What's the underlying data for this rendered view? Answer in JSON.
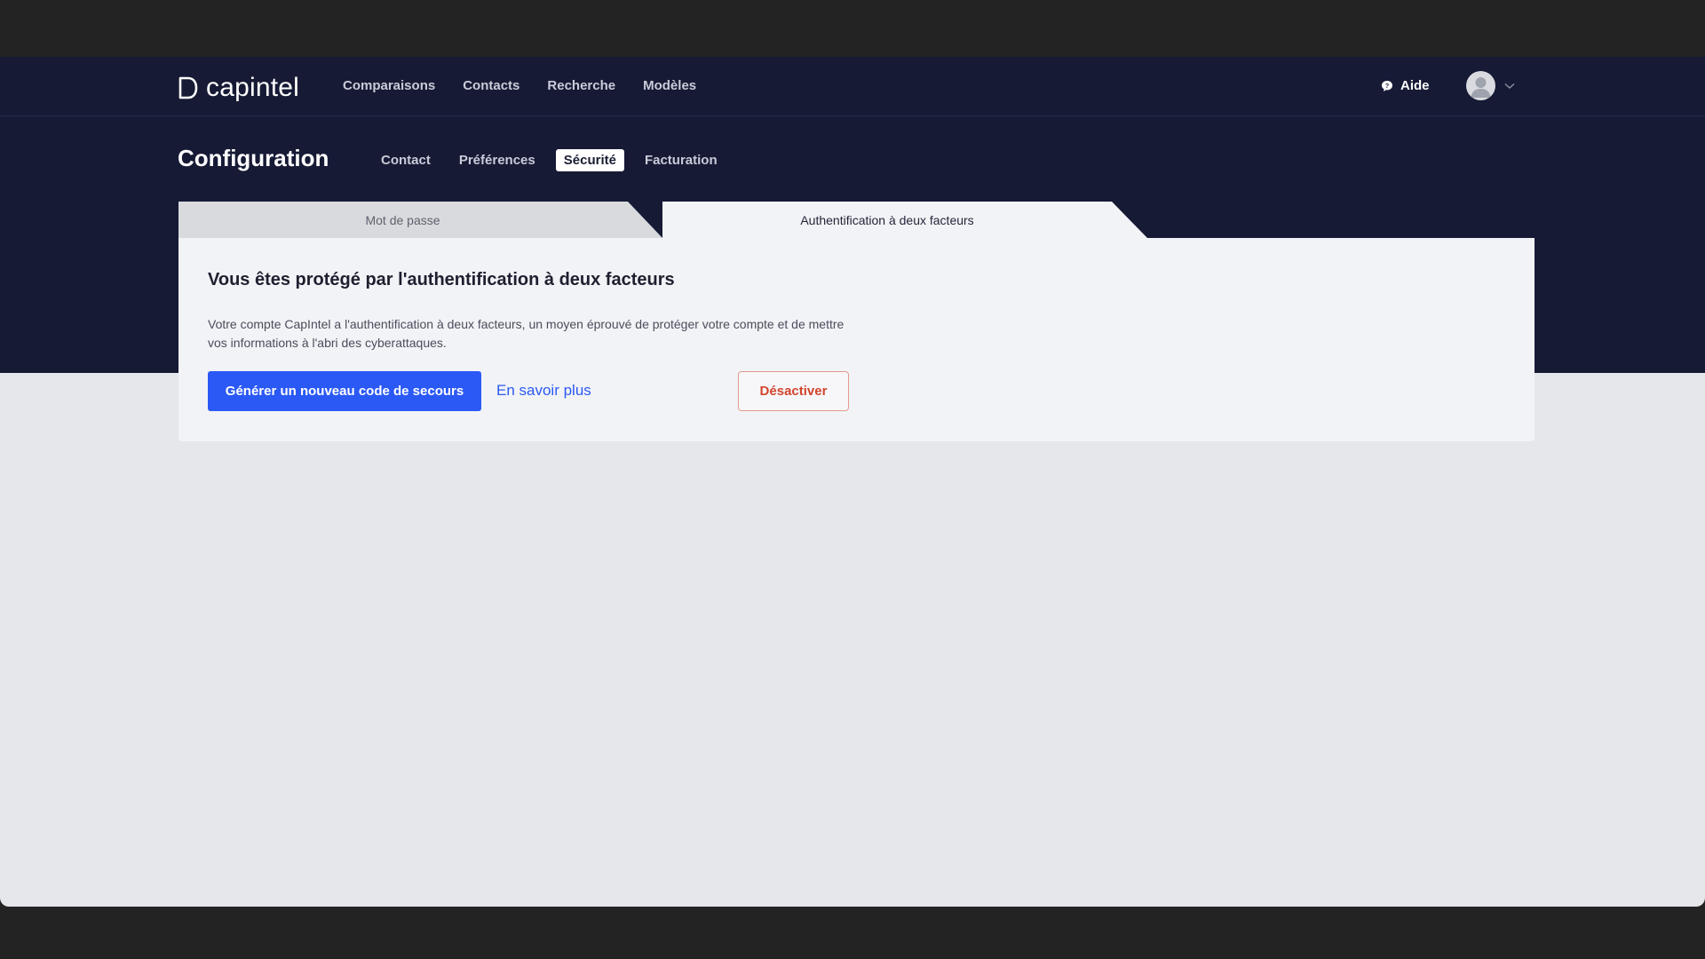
{
  "app": {
    "logo_text": "capintel"
  },
  "topnav": {
    "links": [
      "Comparaisons",
      "Contacts",
      "Recherche",
      "Modèles"
    ],
    "help_label": "Aide"
  },
  "config": {
    "title": "Configuration",
    "tabs": [
      "Contact",
      "Préférences",
      "Sécurité",
      "Facturation"
    ],
    "active_tab": "Sécurité"
  },
  "security": {
    "subtabs": [
      "Mot de passe",
      "Authentification à deux facteurs"
    ],
    "active_subtab": "Authentification à deux facteurs",
    "title": "Vous êtes protégé par l'authentification à deux facteurs",
    "description": "Votre compte CapIntel a l'authentification à deux facteurs, un moyen éprouvé de protéger votre compte et de mettre vos informations à l'abri des cyberattaques.",
    "generate_button": "Générer un nouveau code de secours",
    "learn_more_link": "En savoir plus",
    "disable_button": "Désactiver"
  },
  "colors": {
    "header_bg": "#161a35",
    "primary": "#2b59f5",
    "danger": "#d2452d"
  }
}
